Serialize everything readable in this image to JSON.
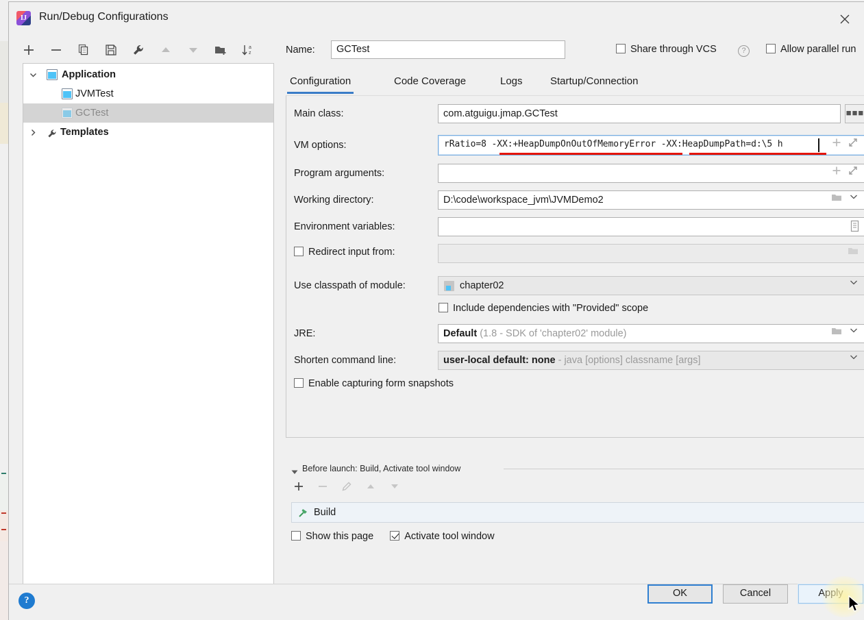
{
  "window": {
    "title": "Run/Debug Configurations",
    "app_icon": "intellij-idea-icon",
    "close_icon": "close-icon"
  },
  "toolbar": {
    "buttons": [
      {
        "name": "add-configuration-button",
        "icon": "plus-icon",
        "enabled": true
      },
      {
        "name": "remove-configuration-button",
        "icon": "minus-icon",
        "enabled": true
      },
      {
        "name": "copy-configuration-button",
        "icon": "copy-icon",
        "enabled": true
      },
      {
        "name": "save-configuration-button",
        "icon": "save-icon",
        "enabled": true
      },
      {
        "name": "edit-templates-button",
        "icon": "wrench-icon",
        "enabled": true
      },
      {
        "name": "move-up-button",
        "icon": "arrow-up-icon",
        "enabled": false
      },
      {
        "name": "move-down-button",
        "icon": "arrow-down-icon",
        "enabled": false
      },
      {
        "name": "new-folder-button",
        "icon": "folder-add-icon",
        "enabled": true
      },
      {
        "name": "sort-configurations-button",
        "icon": "sort-az-icon",
        "enabled": true
      }
    ]
  },
  "tree": {
    "nodes": [
      {
        "label": "Application",
        "icon": "application-icon",
        "indent": 0,
        "expanded": true,
        "selected": false,
        "bold": true,
        "dimmed": false
      },
      {
        "label": "JVMTest",
        "icon": "application-icon",
        "indent": 1,
        "expanded": null,
        "selected": false,
        "bold": false,
        "dimmed": false
      },
      {
        "label": "GCTest",
        "icon": "application-icon",
        "indent": 1,
        "expanded": null,
        "selected": true,
        "bold": false,
        "dimmed": true
      },
      {
        "label": "Templates",
        "icon": "wrench-icon",
        "indent": 0,
        "expanded": false,
        "selected": false,
        "bold": true,
        "dimmed": false
      }
    ]
  },
  "header": {
    "name_label": "Name:",
    "name_value": "GCTest",
    "share_vcs_label": "Share through VCS",
    "share_vcs_checked": false,
    "help_icon": "question-mark-icon",
    "allow_parallel_label": "Allow parallel run",
    "allow_parallel_checked": false
  },
  "tabs": [
    {
      "label": "Configuration",
      "active": true
    },
    {
      "label": "Code Coverage",
      "active": false
    },
    {
      "label": "Logs",
      "active": false
    },
    {
      "label": "Startup/Connection",
      "active": false
    }
  ],
  "configuration": {
    "main_class": {
      "label": "Main class:",
      "value": "com.atguigu.jmap.GCTest",
      "browse_icon": "ellipsis-icon"
    },
    "vm_options": {
      "label": "VM options:",
      "value": "rRatio=8 -XX:+HeapDumpOnOutOfMemoryError -XX:HeapDumpPath=d:\\5 h",
      "focused": true,
      "expand_icon": "expand-icon",
      "insert_icon": "plus-icon",
      "spell_error_color": "#e51400"
    },
    "program_arguments": {
      "label": "Program arguments:",
      "value": "",
      "expand_icon": "expand-icon",
      "insert_icon": "plus-icon"
    },
    "working_directory": {
      "label": "Working directory:",
      "value": "D:\\code\\workspace_jvm\\JVMDemo2",
      "browse_icon": "folder-icon",
      "dropdown_icon": "chevron-down-icon"
    },
    "environment_variables": {
      "label": "Environment variables:",
      "value": "",
      "browse_icon": "list-icon"
    },
    "redirect_input": {
      "label": "Redirect input from:",
      "checked": false,
      "value": "",
      "disabled": true,
      "browse_icon": "folder-icon"
    },
    "use_classpath_of_module": {
      "label": "Use classpath of module:",
      "value": "chapter02",
      "module_icon": "module-icon",
      "dropdown_icon": "chevron-down-icon"
    },
    "include_provided": {
      "label": "Include dependencies with \"Provided\" scope",
      "checked": false
    },
    "jre": {
      "label": "JRE:",
      "value": "Default",
      "hint": "(1.8 - SDK of 'chapter02' module)",
      "browse_icon": "folder-icon",
      "dropdown_icon": "chevron-down-icon"
    },
    "shorten_command_line": {
      "label": "Shorten command line:",
      "value": "user-local default: none",
      "hint": "- java [options] classname [args]",
      "dropdown_icon": "chevron-down-icon"
    },
    "enable_form_snapshots": {
      "label": "Enable capturing form snapshots",
      "checked": false
    }
  },
  "before_launch": {
    "title": "Before launch: Build, Activate tool window",
    "collapse_icon": "triangle-down-icon",
    "toolbar": [
      {
        "name": "add-task-button",
        "icon": "plus-icon",
        "enabled": true
      },
      {
        "name": "remove-task-button",
        "icon": "minus-icon",
        "enabled": false
      },
      {
        "name": "edit-task-button",
        "icon": "pencil-icon",
        "enabled": false
      },
      {
        "name": "move-task-up-button",
        "icon": "arrow-up-icon",
        "enabled": false
      },
      {
        "name": "move-task-down-button",
        "icon": "arrow-down-icon",
        "enabled": false
      }
    ],
    "tasks": [
      {
        "label": "Build",
        "icon": "hammer-icon"
      }
    ],
    "show_this_page": {
      "label": "Show this page",
      "checked": false
    },
    "activate_tool_window": {
      "label": "Activate tool window",
      "checked": true
    }
  },
  "footer": {
    "help_icon": "help-circle-icon",
    "ok_label": "OK",
    "cancel_label": "Cancel",
    "apply_label": "Apply",
    "apply_hovered": true,
    "cursor_icon": "mouse-pointer-icon"
  }
}
